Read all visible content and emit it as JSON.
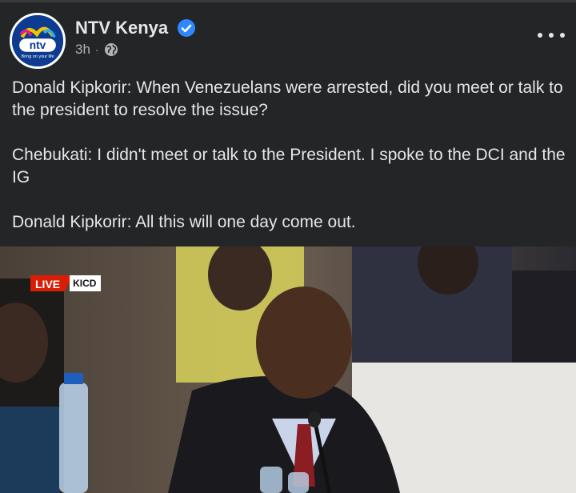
{
  "post": {
    "page_name": "NTV Kenya",
    "avatar_text": "ntv",
    "avatar_tagline": "Bring on your life",
    "timestamp": "3h",
    "separator": "·",
    "visibility_icon": "globe-icon",
    "verified_icon": "verified-badge-icon",
    "more_icon": "more-options-icon",
    "paragraphs": [
      "Donald Kipkorir: When Venezuelans were arrested, did you meet or talk to the president to resolve the issue?",
      "Chebukati: I didn't meet or talk to the President. I spoke to the DCI and the IG",
      "Donald Kipkorir: All this will one day come out."
    ]
  },
  "photo": {
    "live_label": "LIVE",
    "channel_label": "KICD"
  },
  "colors": {
    "background": "#242526",
    "text": "#e4e6eb",
    "secondary_text": "#b0b3b8",
    "verified": "#2d88ff",
    "live_red": "#d81e05"
  }
}
